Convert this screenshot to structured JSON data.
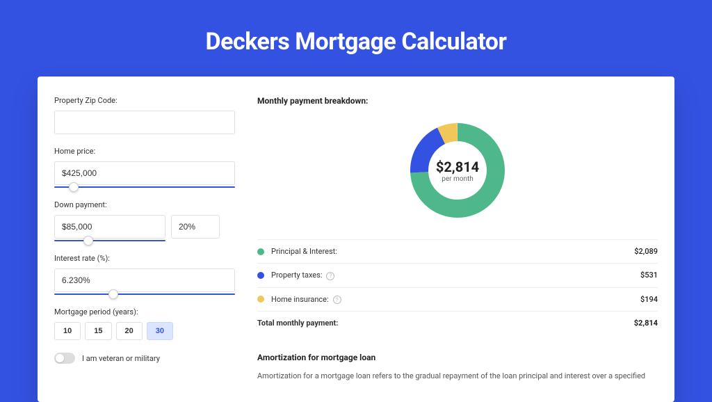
{
  "title": "Deckers Mortgage Calculator",
  "form": {
    "zip_label": "Property Zip Code:",
    "zip_value": "",
    "price_label": "Home price:",
    "price_value": "$425,000",
    "down_label": "Down payment:",
    "down_value": "$85,000",
    "down_percent": "20%",
    "rate_label": "Interest rate (%):",
    "rate_value": "6.230%",
    "period_label": "Mortgage period (years):",
    "periods": [
      "10",
      "15",
      "20",
      "30"
    ],
    "period_active": "30",
    "veteran_label": "I am veteran or military"
  },
  "breakdown": {
    "title": "Monthly payment breakdown:",
    "center_amount": "$2,814",
    "center_sub": "per month",
    "items": [
      {
        "label": "Principal & Interest:",
        "value": "$2,089"
      },
      {
        "label": "Property taxes:",
        "value": "$531",
        "info": true
      },
      {
        "label": "Home insurance:",
        "value": "$194",
        "info": true
      }
    ],
    "total_label": "Total monthly payment:",
    "total_value": "$2,814"
  },
  "amort": {
    "title": "Amortization for mortgage loan",
    "text": "Amortization for a mortgage loan refers to the gradual repayment of the loan principal and interest over a specified"
  },
  "chart_data": {
    "type": "pie",
    "title": "Monthly payment breakdown",
    "series": [
      {
        "name": "Principal & Interest",
        "value": 2089,
        "color": "#4fb88a"
      },
      {
        "name": "Property taxes",
        "value": 531,
        "color": "#3452e1"
      },
      {
        "name": "Home insurance",
        "value": 194,
        "color": "#f0c85a"
      }
    ],
    "total": 2814,
    "center_text": "$2,814 per month"
  }
}
